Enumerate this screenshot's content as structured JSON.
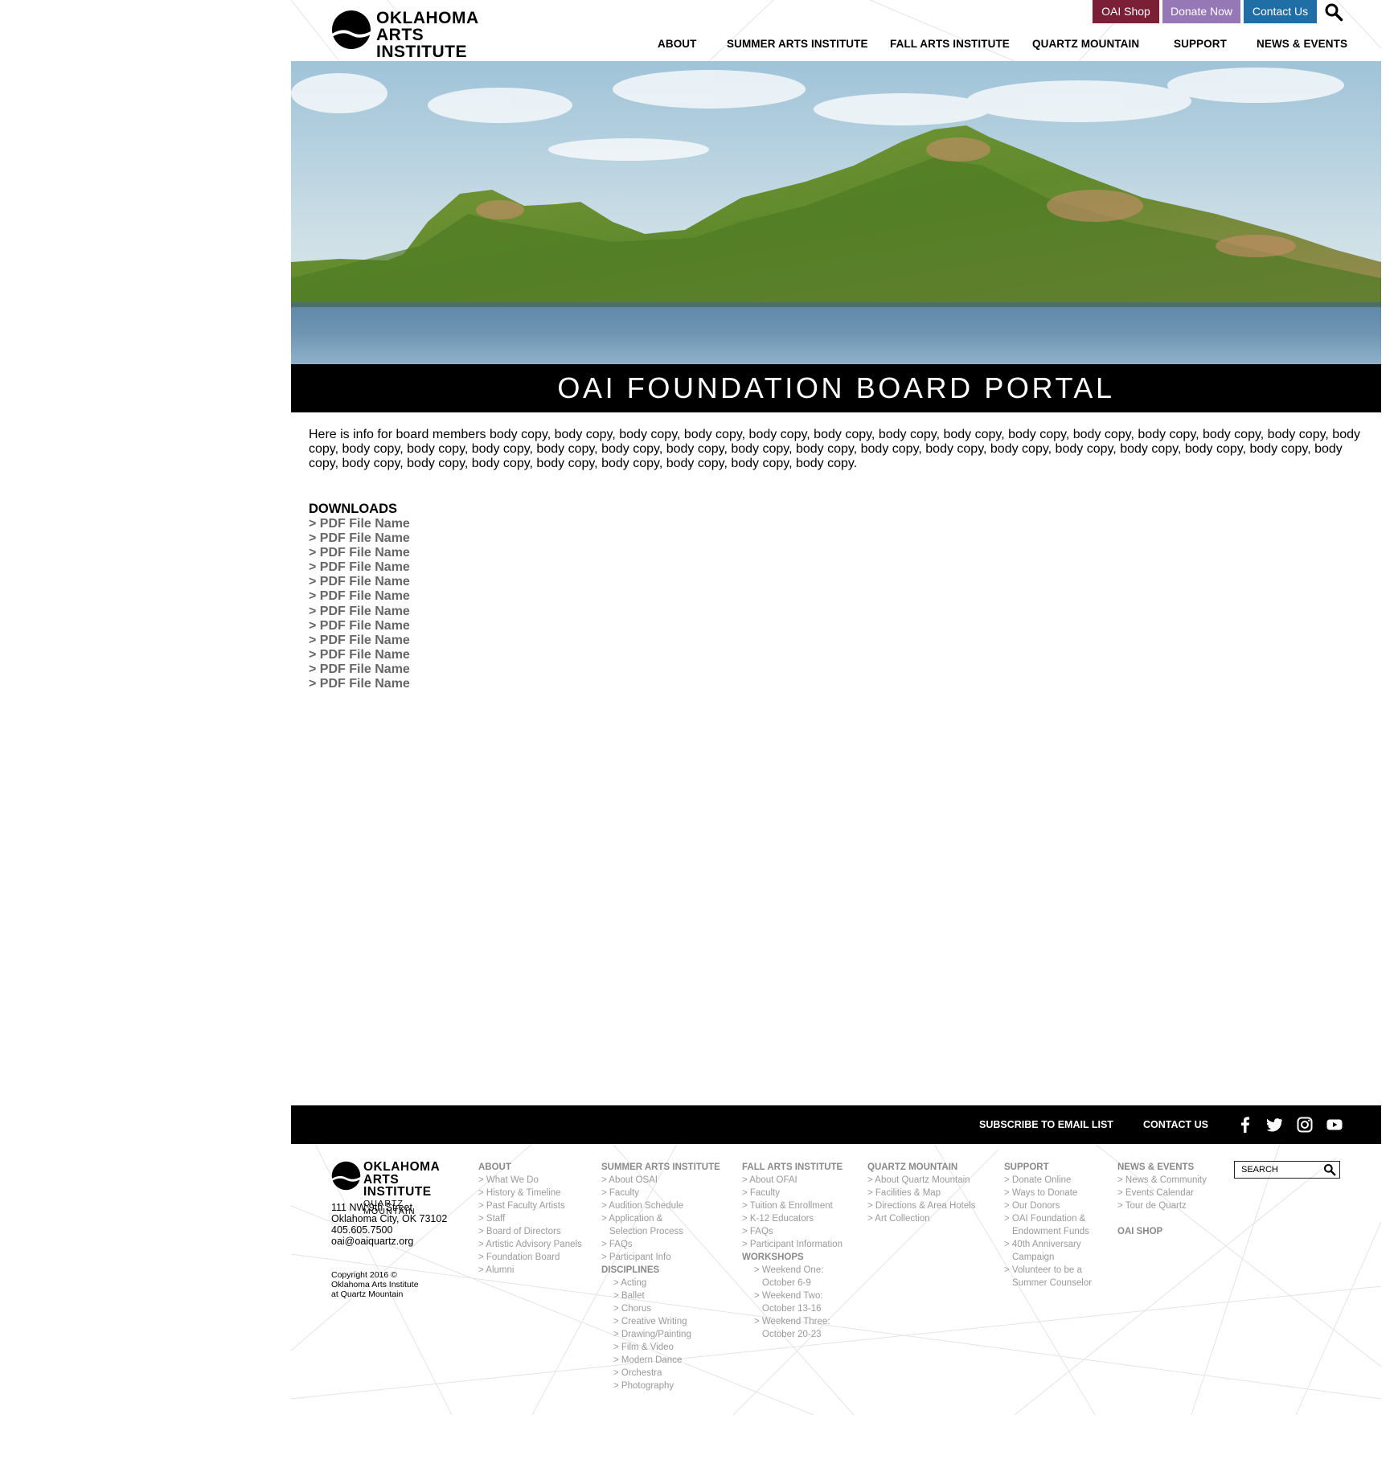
{
  "logo": {
    "line1": "OKLAHOMA",
    "line2": "ARTS INSTITUTE",
    "line3": "QUARTZ MOUNTAIN"
  },
  "utility": {
    "shop": "OAI Shop",
    "donate": "Donate Now",
    "contact": "Contact Us",
    "search_icon": "search-icon",
    "colors": {
      "shop": "#7a1f35",
      "donate": "#9778b6",
      "contact": "#1f6fa6"
    }
  },
  "nav": [
    "ABOUT",
    "SUMMER ARTS INSTITUTE",
    "FALL ARTS INSTITUTE",
    "QUARTZ MOUNTAIN",
    "SUPPORT",
    "NEWS & EVENTS"
  ],
  "page_title": "OAI FOUNDATION BOARD PORTAL",
  "intro": "Here is info for board members body copy, body copy, body copy, body copy, body copy, body copy, body copy, body copy, body copy, body copy, body copy, body copy, body copy, body copy, body copy, body copy, body copy, body copy, body copy, body copy, body copy, body copy, body copy, body copy, body copy, body copy, body copy, body copy, body copy, body copy, body copy, body copy, body copy, body copy, body copy, body copy, body copy, body copy.",
  "downloads": {
    "heading": "DOWNLOADS",
    "items": [
      "> PDF File Name",
      "> PDF File Name",
      "> PDF File Name",
      "> PDF File Name",
      "> PDF File Name",
      "> PDF File Name",
      "> PDF File Name",
      "> PDF File Name",
      "> PDF File Name",
      "> PDF File Name",
      "> PDF File Name",
      "> PDF File Name"
    ]
  },
  "footer_bar": {
    "subscribe": "SUBSCRIBE TO EMAIL LIST",
    "contact": "CONTACT US",
    "social_icons": [
      "facebook-icon",
      "twitter-icon",
      "instagram-icon",
      "youtube-icon"
    ]
  },
  "footer": {
    "address": [
      "111 NW 9th Street",
      "Oklahoma City, OK 73102",
      "405.605.7500",
      "oai@oaiquartz.org"
    ],
    "copyright": [
      "Copyright 2016 ©",
      "Oklahoma Arts Institute",
      "at Quartz Mountain"
    ],
    "about": {
      "heading": "ABOUT",
      "items": [
        "> What We Do",
        "> History & Timeline",
        "> Past Faculty Artists",
        "> Staff",
        "> Board of Directors",
        "> Artistic Advisory Panels",
        "> Foundation Board",
        "> Alumni"
      ]
    },
    "summer": {
      "heading": "SUMMER ARTS INSTITUTE",
      "items": [
        "> About OSAI",
        "> Faculty",
        "> Audition Schedule",
        "> Application & Selection Process",
        "> FAQs",
        "> Participant Info"
      ],
      "disciplines_heading": "DISCIPLINES",
      "disciplines": [
        "> Acting",
        "> Ballet",
        "> Chorus",
        "> Creative Writing",
        "> Drawing/Painting",
        "> Film & Video",
        "> Modern Dance",
        "> Orchestra",
        "> Photography"
      ]
    },
    "fall": {
      "heading": "FALL ARTS INSTITUTE",
      "items": [
        "> About OFAI",
        "> Faculty",
        "> Tuition & Enrollment",
        "> K-12 Educators",
        "> FAQs",
        "> Participant Information"
      ],
      "workshops_heading": "WORKSHOPS",
      "workshops": [
        "> Weekend One: October 6-9",
        "> Weekend Two: October 13-16",
        "> Weekend Three: October 20-23"
      ]
    },
    "quartz": {
      "heading": "QUARTZ MOUNTAIN",
      "items": [
        "> About Quartz Mountain",
        "> Facilities & Map",
        "> Directions & Area Hotels",
        "> Art Collection"
      ]
    },
    "support": {
      "heading": "SUPPORT",
      "items": [
        "> Donate Online",
        "> Ways to Donate",
        "> Our Donors",
        "> OAI Foundation & Endowment Funds",
        "> 40th Anniversary Campaign",
        "> Volunteer to be a Summer Counselor"
      ]
    },
    "news": {
      "heading": "NEWS & EVENTS",
      "items": [
        "> News & Community",
        "> Events Calendar",
        "> Tour de Quartz"
      ],
      "shop": "OAI SHOP"
    },
    "search_placeholder": "SEARCH"
  }
}
